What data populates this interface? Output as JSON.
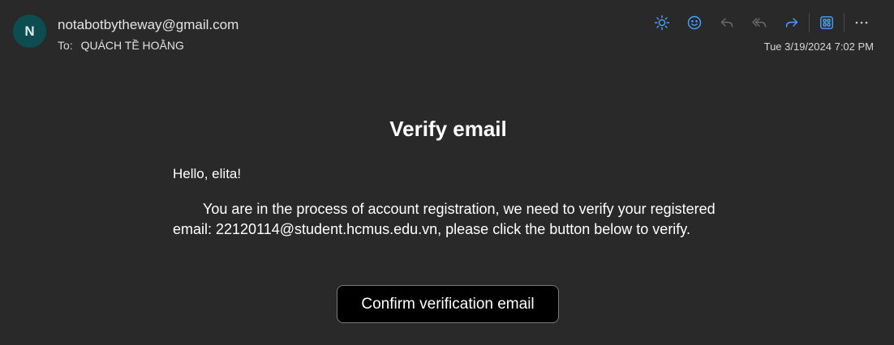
{
  "header": {
    "avatar_initial": "N",
    "sender": "notabotbytheway@gmail.com",
    "to_label": "To:",
    "recipient": "QUÁCH TỀ HOẰNG",
    "date": "Tue 3/19/2024 7:02 PM"
  },
  "toolbar": {
    "icons": [
      "brightness-icon",
      "emoji-icon",
      "reply-icon",
      "reply-all-icon",
      "forward-icon",
      "apps-icon",
      "more-icon"
    ],
    "accent_color": "#4ca0ff",
    "disabled_color": "#6a6a6a"
  },
  "email": {
    "title": "Verify email",
    "greeting": "Hello, elita!",
    "body": "You are in the process of account registration, we need to verify your registered email: 22120114@student.hcmus.edu.vn, please click the button below to verify.",
    "button_label": "Confirm verification email"
  }
}
